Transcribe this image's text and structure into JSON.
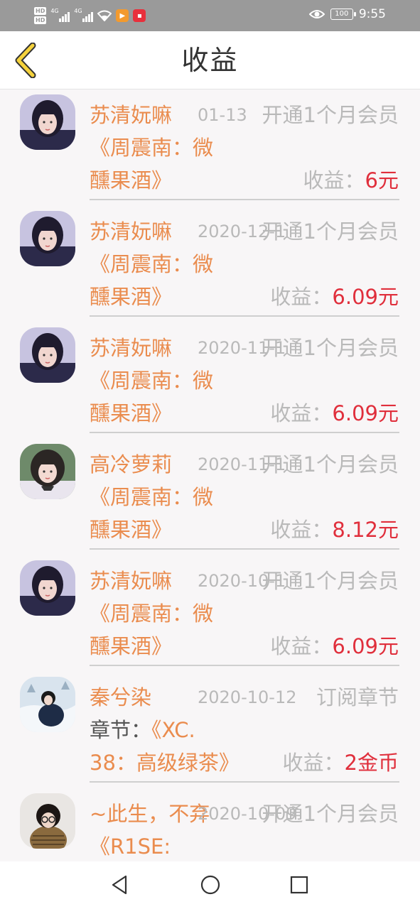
{
  "status_bar": {
    "hd1": "HD",
    "hd2": "HD",
    "net1": "4G",
    "net2": "4G",
    "battery": "100",
    "time": "9:55",
    "icons": [
      "signal-icon",
      "wifi-icon",
      "video-app-icon",
      "shop-app-icon",
      "eye-icon",
      "battery-icon"
    ]
  },
  "header": {
    "title": "收益",
    "back_icon": "chevron-left-icon",
    "accent": "#f5d23c"
  },
  "colors": {
    "name": "#ea8c4e",
    "muted": "#b9b9b9",
    "amount": "#e02f3c"
  },
  "items": [
    {
      "name": "苏清妧嘛",
      "time": "01-13",
      "type": "开通1个月会员",
      "line2": "《周震南：微",
      "line3_prefix": "",
      "line3": "醺果酒》",
      "income_label": "收益：",
      "income_value": "6元",
      "avatar": "girl-portrait-a"
    },
    {
      "name": "苏清妧嘛",
      "time": "2020-12-1",
      "type": "开通1个月会员",
      "line2": "《周震南：微",
      "line3_prefix": "",
      "line3": "醺果酒》",
      "income_label": "收益：",
      "income_value": "6.09元",
      "avatar": "girl-portrait-a"
    },
    {
      "name": "苏清妧嘛",
      "time": "2020-11-1",
      "type": "开通1个月会员",
      "line2": "《周震南：微",
      "line3_prefix": "",
      "line3": "醺果酒》",
      "income_label": "收益：",
      "income_value": "6.09元",
      "avatar": "girl-portrait-a"
    },
    {
      "name": "高冷萝莉",
      "time": "2020-11-1",
      "type": "开通1个月会员",
      "line2": "《周震南：微",
      "line3_prefix": "",
      "line3": "醺果酒》",
      "income_label": "收益：",
      "income_value": "8.12元",
      "avatar": "girl-portrait-b"
    },
    {
      "name": "苏清妧嘛",
      "time": "2020-10-1",
      "type": "开通1个月会员",
      "line2": "《周震南：微",
      "line3_prefix": "",
      "line3": "醺果酒》",
      "income_label": "收益：",
      "income_value": "6.09元",
      "avatar": "girl-portrait-a"
    },
    {
      "name": "秦兮染",
      "time": "2020-10-12",
      "type": "订阅章节",
      "line2_prefix": "章节：",
      "line2": "《XC.",
      "line3_prefix": "",
      "line3": "38：高级绿茶》",
      "income_label": "收益：",
      "income_value": "2金币",
      "avatar": "snow-portrait"
    },
    {
      "name": "~此生，不弃",
      "time": "2020-10-09",
      "type": "开通1个月会员",
      "line2": "《R1SE:",
      "line3_prefix": "",
      "line3": "",
      "income_label": "",
      "income_value": "",
      "avatar": "glasses-portrait"
    }
  ],
  "nav": {
    "back": "triangle-back-icon",
    "home": "circle-home-icon",
    "recent": "square-recent-icon"
  }
}
